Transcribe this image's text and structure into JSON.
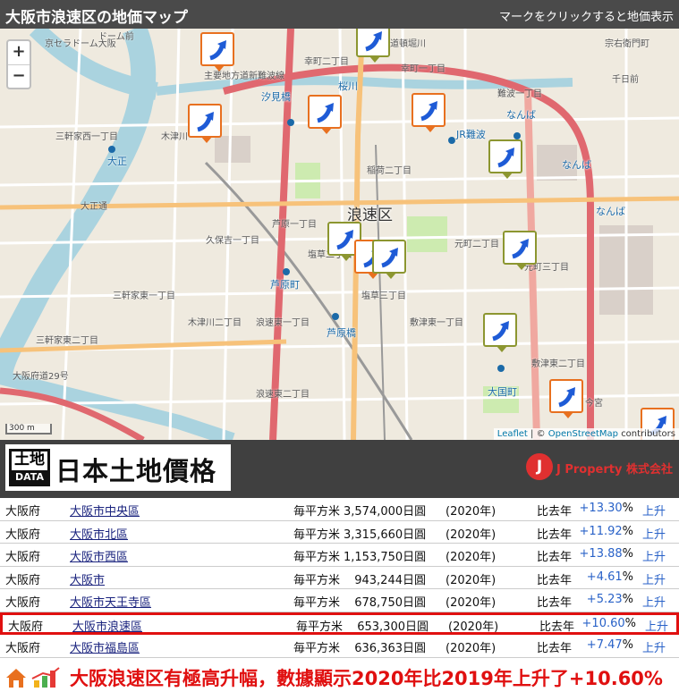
{
  "header": {
    "title": "大阪市浪速区の地価マップ",
    "hint": "マークをクリックすると地価表示"
  },
  "map": {
    "zoom_in": "+",
    "zoom_out": "−",
    "area_label": "浪速区",
    "scale_label": "300 m",
    "attribution": {
      "leaflet": "Leaflet",
      "separator": "| ©",
      "osm": "OpenStreetMap",
      "contributors": "contributors"
    },
    "stations": [
      {
        "name": "汐見橋"
      },
      {
        "name": "桜川"
      },
      {
        "name": "JR難波"
      },
      {
        "name": "なんば"
      },
      {
        "name": "なんば"
      },
      {
        "name": "なんば"
      },
      {
        "name": "大正"
      },
      {
        "name": "芦原町"
      },
      {
        "name": "芦原橋"
      },
      {
        "name": "大国町"
      }
    ],
    "streets": [
      {
        "name": "京セラドーム大阪"
      },
      {
        "name": "ドーム前"
      },
      {
        "name": "道頓堀川"
      },
      {
        "name": "幸町二丁目"
      },
      {
        "name": "幸町一丁目"
      },
      {
        "name": "主要地方道新難波線"
      },
      {
        "name": "三軒家西一丁目"
      },
      {
        "name": "木津川"
      },
      {
        "name": "大正通"
      },
      {
        "name": "稲荷二丁目"
      },
      {
        "name": "芦原一丁目"
      },
      {
        "name": "久保吉一丁目"
      },
      {
        "name": "塩草二丁目"
      },
      {
        "name": "元町二丁目"
      },
      {
        "name": "元町三丁目"
      },
      {
        "name": "塩草三丁目"
      },
      {
        "name": "敷津東一丁目"
      },
      {
        "name": "敷津東二丁目"
      },
      {
        "name": "三軒家東一丁目"
      },
      {
        "name": "三軒家東二丁目"
      },
      {
        "name": "木津川二丁目"
      },
      {
        "name": "浪速東一丁目"
      },
      {
        "name": "大阪府道29号"
      },
      {
        "name": "浪速東二丁目"
      },
      {
        "name": "今宮"
      },
      {
        "name": "千日前"
      },
      {
        "name": "宗右衛門町"
      },
      {
        "name": "難波一丁目"
      }
    ]
  },
  "banner": {
    "badge_kanji": "土地",
    "badge_data": "DATA",
    "logo_text": "日本土地價格",
    "company_mark": "J",
    "company_name": "J Property 株式会社"
  },
  "rows": [
    {
      "pref": "大阪府",
      "city": "大阪市中央區",
      "label": "毎平方米",
      "price": "3,574,000日圓",
      "year": "(2020年)",
      "comp": "比去年",
      "change": "+13.30",
      "unit": "%",
      "status": "上升"
    },
    {
      "pref": "大阪府",
      "city": "大阪市北區",
      "label": "毎平方米",
      "price": "3,315,660日圓",
      "year": "(2020年)",
      "comp": "比去年",
      "change": "+11.92",
      "unit": "%",
      "status": "上升"
    },
    {
      "pref": "大阪府",
      "city": "大阪市西區",
      "label": "毎平方米",
      "price": "1,153,750日圓",
      "year": "(2020年)",
      "comp": "比去年",
      "change": "+13.88",
      "unit": "%",
      "status": "上升"
    },
    {
      "pref": "大阪府",
      "city": "大阪市",
      "label": "毎平方米",
      "price": "943,244日圓",
      "year": "(2020年)",
      "comp": "比去年",
      "change": "+4.61",
      "unit": "%",
      "status": "上升"
    },
    {
      "pref": "大阪府",
      "city": "大阪市天王寺區",
      "label": "毎平方米",
      "price": "678,750日圓",
      "year": "(2020年)",
      "comp": "比去年",
      "change": "+5.23",
      "unit": "%",
      "status": "上升"
    },
    {
      "pref": "大阪府",
      "city": "大阪市浪速區",
      "label": "毎平方米",
      "price": "653,300日圓",
      "year": "(2020年)",
      "comp": "比去年",
      "change": "+10.60",
      "unit": "%",
      "status": "上升"
    },
    {
      "pref": "大阪府",
      "city": "大阪市福島區",
      "label": "毎平方米",
      "price": "636,363日圓",
      "year": "(2020年)",
      "comp": "比去年",
      "change": "+7.47",
      "unit": "%",
      "status": "上升"
    }
  ],
  "caption": {
    "text": "大阪浪速区有極高升幅，數據顯示2020年比2019年上升了+10.60%"
  },
  "colors": {
    "highlight": "#e01010",
    "link": "#1a237e",
    "change": "#2962c8",
    "marker_orange": "#e8701f",
    "marker_olive": "#8c9630"
  }
}
